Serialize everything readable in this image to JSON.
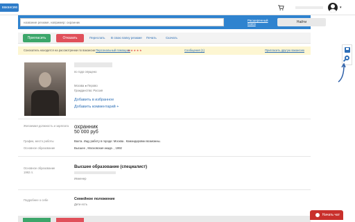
{
  "topbar": {
    "logo_label": "вакансию",
    "user_name": "",
    "caret": "▾"
  },
  "search": {
    "placeholder": "название резюме, например: охранник",
    "advanced_label": "Расширенный поиск",
    "find_label": "Найти"
  },
  "actions": {
    "invite_label": "Пригласить",
    "reject_label": "Отказать",
    "forward_label": "Переслать",
    "folder_label": "В свою папку резюме",
    "print_label": "Печать",
    "save_label": "Скачать"
  },
  "notice": {
    "text": "Соискатель находится на рассмотрении по вакансии",
    "link": "Персональный помощник",
    "stars": "★★★★★",
    "messages": "Сообщения (1)",
    "right_link": "Пригласить другую вакансию"
  },
  "profile": {
    "age_line": "по годо опущено",
    "city_line": "Москва ● Перово",
    "citizenship": "Гражданство: Россия",
    "add_favorite": "Добавить в избранное",
    "add_comment": "Добавить комментарий +",
    "desired_label": "Желаемая должность и зарплата",
    "position": "охранник",
    "salary": "50 000 руб",
    "schedule_label": "График, место работы",
    "schedule_value": "Вахта. Ищу работу в городе: Москва . Командировки возможны.",
    "edu_short_label": "Основное образование",
    "edu_short_value": "Высшее , Московская акаде. , 1992",
    "edu_label": "Основное образование",
    "edu_year": "1992 гг.",
    "edu_title": "Высшее образование (специалист)",
    "edu_sub": "Инженер",
    "more_label": "Подробнее о себе",
    "family_title": "Семейное положение",
    "family_value": "Дети есть"
  },
  "chat": {
    "label": "Начать чат"
  },
  "colors": {
    "accent": "#2f83cf",
    "green": "#3ca66a",
    "red": "#e0505a",
    "notice": "#fdf6d2"
  }
}
